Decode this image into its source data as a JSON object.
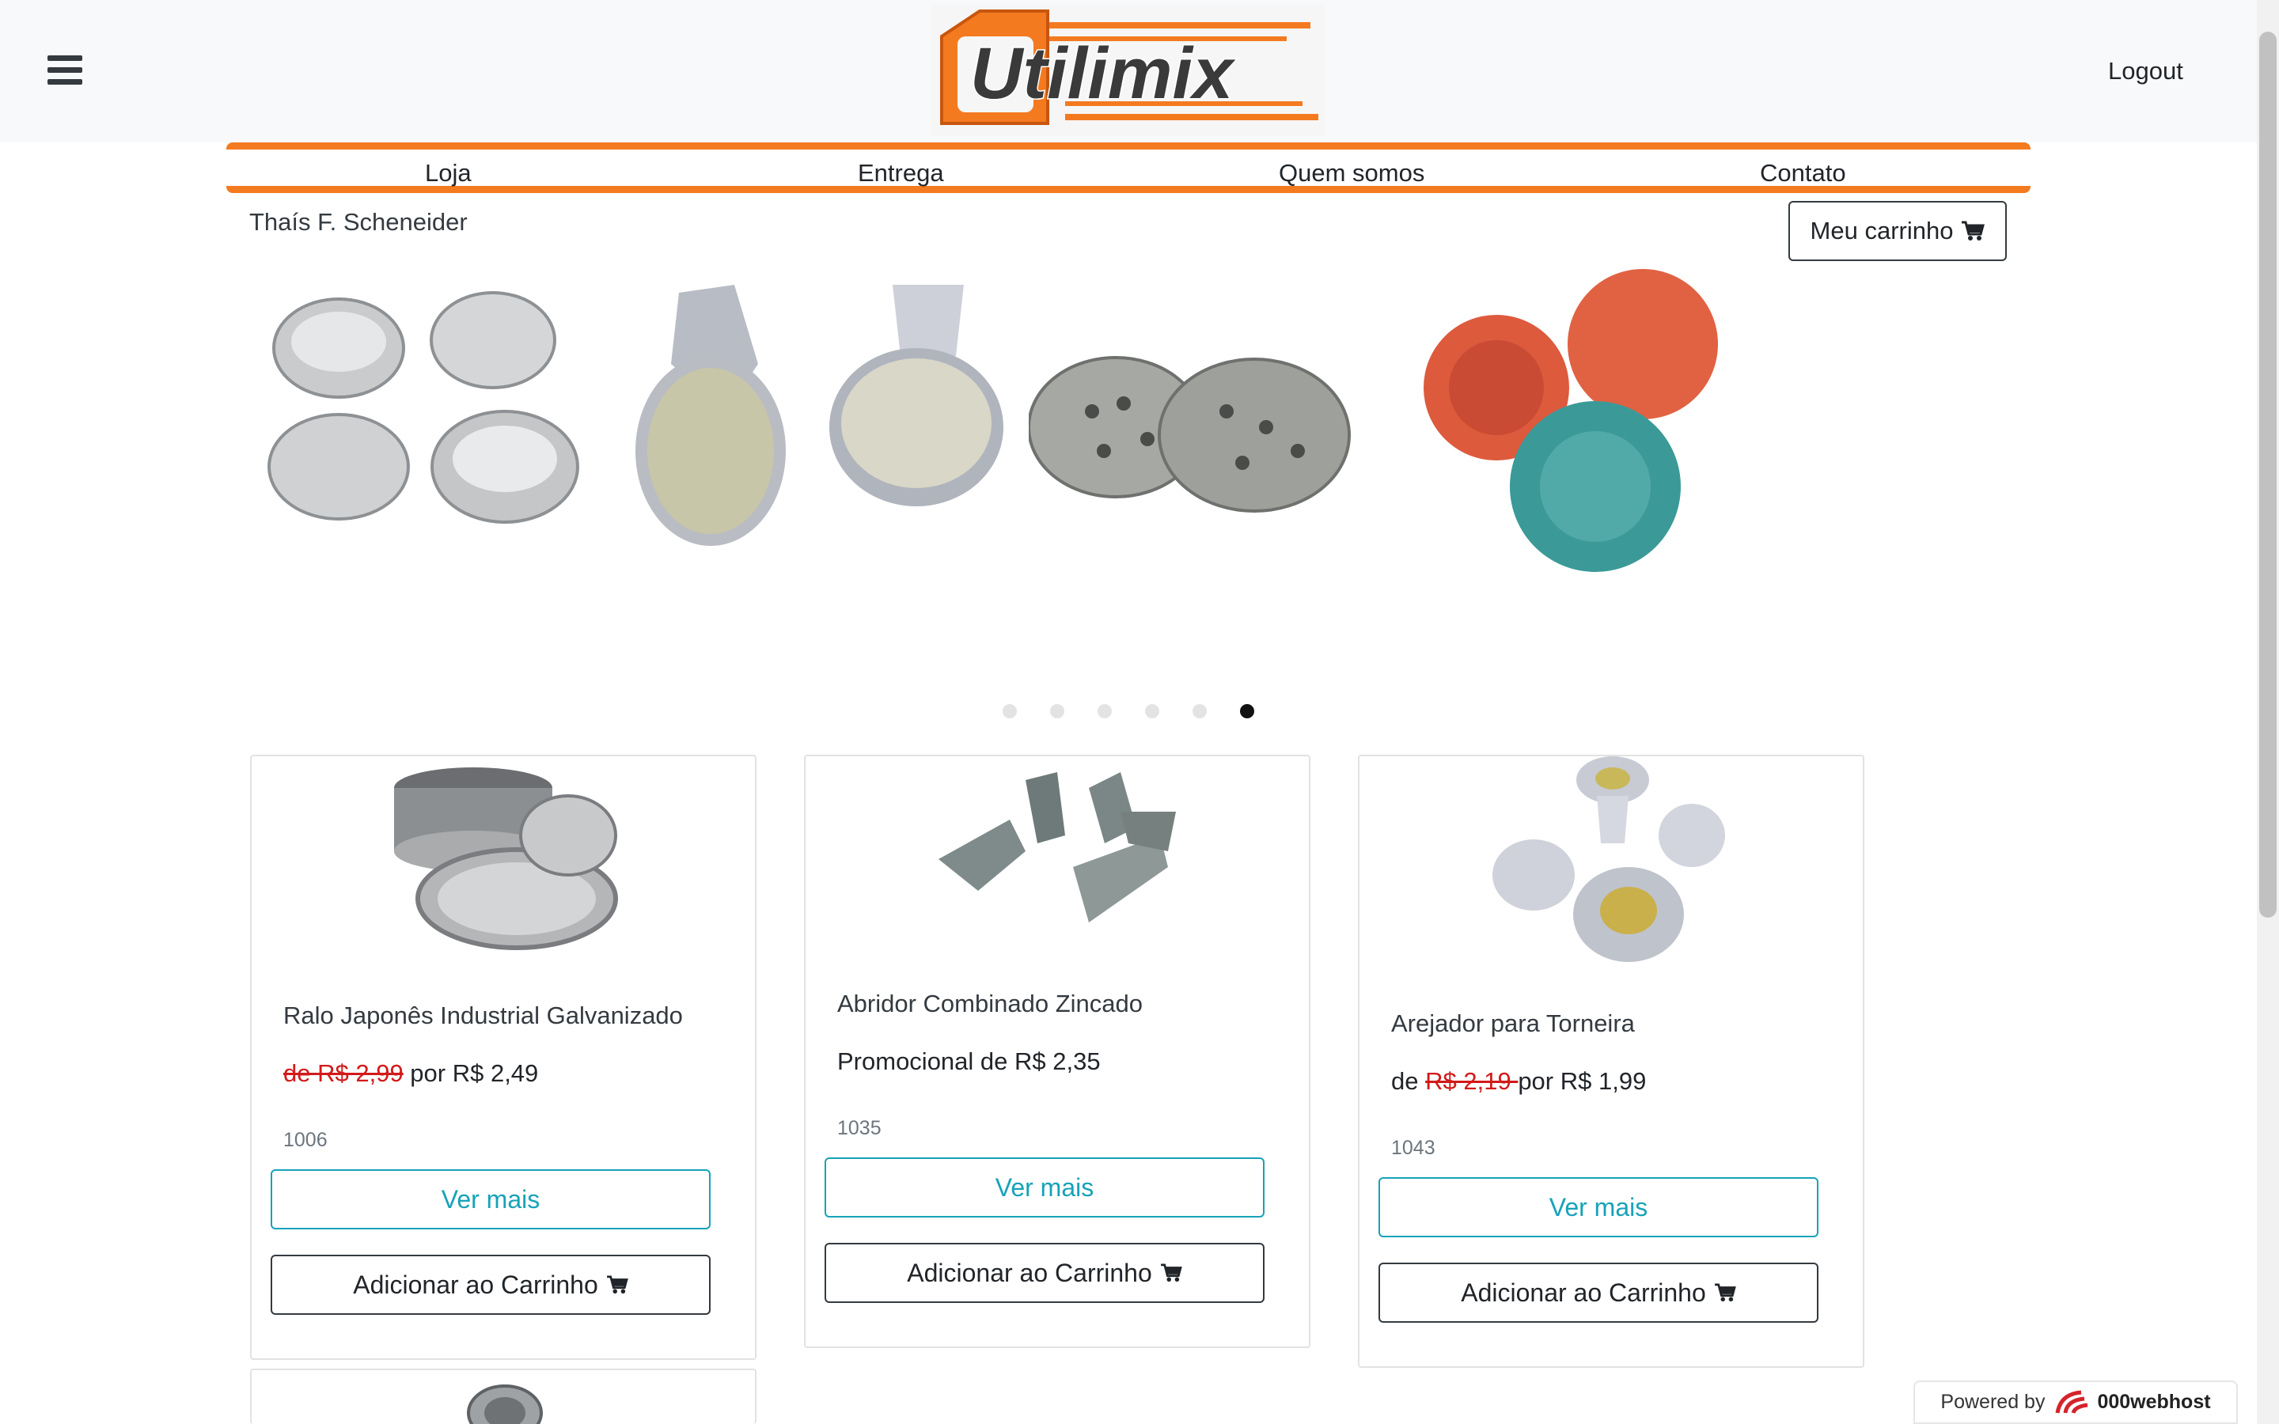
{
  "header": {
    "brand": "Utilimix",
    "logout_label": "Logout",
    "menu_icon": "hamburger-icon",
    "colors": {
      "accent": "#f47a20",
      "dark": "#343a40"
    }
  },
  "nav": {
    "items": [
      {
        "label": "Loja"
      },
      {
        "label": "Entrega"
      },
      {
        "label": "Quem somos"
      },
      {
        "label": "Contato"
      }
    ]
  },
  "user": {
    "name": "Thaís F. Scheneider"
  },
  "cart": {
    "label": "Meu carrinho",
    "icon": "cart-icon"
  },
  "carousel": {
    "dots": 6,
    "active_index": 5
  },
  "products": [
    {
      "name": "Ralo Japonês Industrial Galvanizado",
      "price_prefix": "de ",
      "old_price": "R$ 2,99",
      "price_suffix": " por R$ 2,49",
      "code": "1006",
      "view_label": "Ver mais",
      "add_label": "Adicionar ao Carrinho"
    },
    {
      "name": "Abridor Combinado Zincado",
      "price_text": "Promocional de R$ 2,35",
      "code": "1035",
      "view_label": "Ver mais",
      "add_label": "Adicionar ao Carrinho"
    },
    {
      "name": "Arejador para Torneira",
      "price_prefix": "de ",
      "old_price": "R$ 2,19 ",
      "price_suffix": "por R$ 1,99",
      "code": "1043",
      "view_label": "Ver mais",
      "add_label": "Adicionar ao Carrinho"
    }
  ],
  "footer": {
    "powered_label": "Powered by",
    "host_name": "000webhost"
  }
}
